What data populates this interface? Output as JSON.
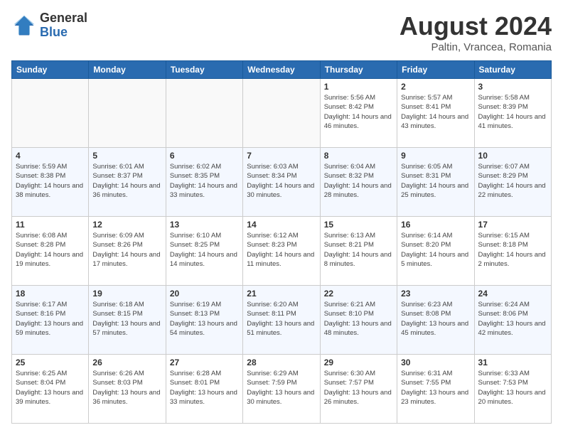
{
  "header": {
    "logo_general": "General",
    "logo_blue": "Blue",
    "main_title": "August 2024",
    "subtitle": "Paltin, Vrancea, Romania"
  },
  "weekdays": [
    "Sunday",
    "Monday",
    "Tuesday",
    "Wednesday",
    "Thursday",
    "Friday",
    "Saturday"
  ],
  "weeks": [
    [
      {
        "day": "",
        "info": ""
      },
      {
        "day": "",
        "info": ""
      },
      {
        "day": "",
        "info": ""
      },
      {
        "day": "",
        "info": ""
      },
      {
        "day": "1",
        "info": "Sunrise: 5:56 AM\nSunset: 8:42 PM\nDaylight: 14 hours\nand 46 minutes."
      },
      {
        "day": "2",
        "info": "Sunrise: 5:57 AM\nSunset: 8:41 PM\nDaylight: 14 hours\nand 43 minutes."
      },
      {
        "day": "3",
        "info": "Sunrise: 5:58 AM\nSunset: 8:39 PM\nDaylight: 14 hours\nand 41 minutes."
      }
    ],
    [
      {
        "day": "4",
        "info": "Sunrise: 5:59 AM\nSunset: 8:38 PM\nDaylight: 14 hours\nand 38 minutes."
      },
      {
        "day": "5",
        "info": "Sunrise: 6:01 AM\nSunset: 8:37 PM\nDaylight: 14 hours\nand 36 minutes."
      },
      {
        "day": "6",
        "info": "Sunrise: 6:02 AM\nSunset: 8:35 PM\nDaylight: 14 hours\nand 33 minutes."
      },
      {
        "day": "7",
        "info": "Sunrise: 6:03 AM\nSunset: 8:34 PM\nDaylight: 14 hours\nand 30 minutes."
      },
      {
        "day": "8",
        "info": "Sunrise: 6:04 AM\nSunset: 8:32 PM\nDaylight: 14 hours\nand 28 minutes."
      },
      {
        "day": "9",
        "info": "Sunrise: 6:05 AM\nSunset: 8:31 PM\nDaylight: 14 hours\nand 25 minutes."
      },
      {
        "day": "10",
        "info": "Sunrise: 6:07 AM\nSunset: 8:29 PM\nDaylight: 14 hours\nand 22 minutes."
      }
    ],
    [
      {
        "day": "11",
        "info": "Sunrise: 6:08 AM\nSunset: 8:28 PM\nDaylight: 14 hours\nand 19 minutes."
      },
      {
        "day": "12",
        "info": "Sunrise: 6:09 AM\nSunset: 8:26 PM\nDaylight: 14 hours\nand 17 minutes."
      },
      {
        "day": "13",
        "info": "Sunrise: 6:10 AM\nSunset: 8:25 PM\nDaylight: 14 hours\nand 14 minutes."
      },
      {
        "day": "14",
        "info": "Sunrise: 6:12 AM\nSunset: 8:23 PM\nDaylight: 14 hours\nand 11 minutes."
      },
      {
        "day": "15",
        "info": "Sunrise: 6:13 AM\nSunset: 8:21 PM\nDaylight: 14 hours\nand 8 minutes."
      },
      {
        "day": "16",
        "info": "Sunrise: 6:14 AM\nSunset: 8:20 PM\nDaylight: 14 hours\nand 5 minutes."
      },
      {
        "day": "17",
        "info": "Sunrise: 6:15 AM\nSunset: 8:18 PM\nDaylight: 14 hours\nand 2 minutes."
      }
    ],
    [
      {
        "day": "18",
        "info": "Sunrise: 6:17 AM\nSunset: 8:16 PM\nDaylight: 13 hours\nand 59 minutes."
      },
      {
        "day": "19",
        "info": "Sunrise: 6:18 AM\nSunset: 8:15 PM\nDaylight: 13 hours\nand 57 minutes."
      },
      {
        "day": "20",
        "info": "Sunrise: 6:19 AM\nSunset: 8:13 PM\nDaylight: 13 hours\nand 54 minutes."
      },
      {
        "day": "21",
        "info": "Sunrise: 6:20 AM\nSunset: 8:11 PM\nDaylight: 13 hours\nand 51 minutes."
      },
      {
        "day": "22",
        "info": "Sunrise: 6:21 AM\nSunset: 8:10 PM\nDaylight: 13 hours\nand 48 minutes."
      },
      {
        "day": "23",
        "info": "Sunrise: 6:23 AM\nSunset: 8:08 PM\nDaylight: 13 hours\nand 45 minutes."
      },
      {
        "day": "24",
        "info": "Sunrise: 6:24 AM\nSunset: 8:06 PM\nDaylight: 13 hours\nand 42 minutes."
      }
    ],
    [
      {
        "day": "25",
        "info": "Sunrise: 6:25 AM\nSunset: 8:04 PM\nDaylight: 13 hours\nand 39 minutes."
      },
      {
        "day": "26",
        "info": "Sunrise: 6:26 AM\nSunset: 8:03 PM\nDaylight: 13 hours\nand 36 minutes."
      },
      {
        "day": "27",
        "info": "Sunrise: 6:28 AM\nSunset: 8:01 PM\nDaylight: 13 hours\nand 33 minutes."
      },
      {
        "day": "28",
        "info": "Sunrise: 6:29 AM\nSunset: 7:59 PM\nDaylight: 13 hours\nand 30 minutes."
      },
      {
        "day": "29",
        "info": "Sunrise: 6:30 AM\nSunset: 7:57 PM\nDaylight: 13 hours\nand 26 minutes."
      },
      {
        "day": "30",
        "info": "Sunrise: 6:31 AM\nSunset: 7:55 PM\nDaylight: 13 hours\nand 23 minutes."
      },
      {
        "day": "31",
        "info": "Sunrise: 6:33 AM\nSunset: 7:53 PM\nDaylight: 13 hours\nand 20 minutes."
      }
    ]
  ]
}
